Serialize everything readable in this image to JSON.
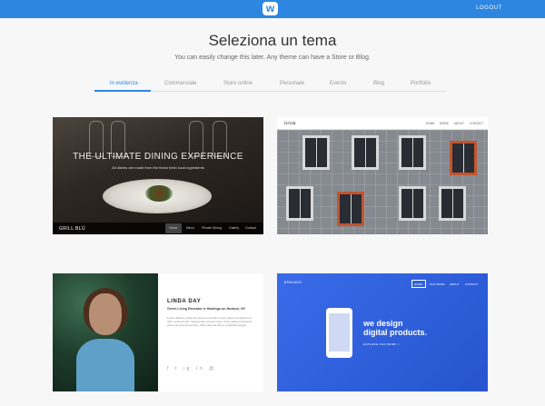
{
  "topbar": {
    "logo": "w",
    "logout": "LOGOUT",
    "color": "#2d86e0"
  },
  "heading": "Seleziona un tema",
  "subtitle": "You can easily change this later. Any theme can have a Store or Blog.",
  "tabs": [
    "In evidenza",
    "Commerciale",
    "Store online",
    "Personale",
    "Events",
    "Blog",
    "Portfolio"
  ],
  "active_tab": "In evidenza",
  "cards": [
    {
      "name": "Grill Blu",
      "title": "THE ULTIMATE DINING EXPERIENCE",
      "subtitle": "All dishes are made from the finest fresh local ingredients",
      "brand": "GRILL BLÜ",
      "nav": [
        "Home",
        "Menu",
        "Private Dining",
        "Gallery",
        "Contact"
      ]
    },
    {
      "name": "brisk",
      "brand": "brisk",
      "nav": [
        "HOME",
        "WORK",
        "ABOUT",
        "CONTACT"
      ]
    },
    {
      "name": "Linda Day",
      "title": "LINDA DAY",
      "role": "Green Living Educator in Hastings-on-Hudson, NY",
      "bio": "Fusce dapibus, tellus ac cursus commodo, tortor mauris condimentum nibh, ut fermentum massa justo sit amet risus. Cras mattis consectetur purus sit amet fermentum. Nulla vitae elit libero, a pharetra augue.",
      "social": [
        "f",
        "t",
        "ig",
        "in",
        "@"
      ]
    },
    {
      "name": "Bravado",
      "brand": "BRAVADO",
      "nav": [
        "HOME",
        "OUR WORK",
        "ABOUT",
        "CONTACT"
      ],
      "headline_1": "we design",
      "headline_2": "digital products.",
      "link": "EXPLORE OUR WORK >"
    }
  ]
}
